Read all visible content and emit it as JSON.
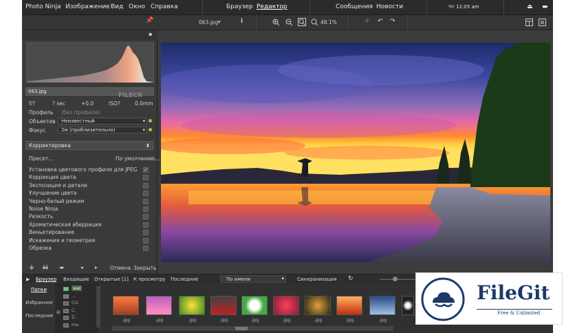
{
  "menu": {
    "app": "Photo Ninja",
    "image": "Изображение",
    "view": "Вид",
    "window": "Окно",
    "help": "Справка",
    "browser": "Браузер",
    "editor": "Редактор",
    "messages": "Сообщения",
    "news": "Новости",
    "clock": "Чт 12:05 am"
  },
  "toolbar": {
    "filename": "063.jpg",
    "zoom": "48.1%"
  },
  "watermark": "FILECR",
  "info": {
    "filename": "063.jpg",
    "aperture": "f/?",
    "shutter": "? sec",
    "ev": "+0.0",
    "iso": "ISO?",
    "focal": "0.0mm",
    "profile_label": "Профиль",
    "profile_value": "(без профиля)",
    "lens_label": "Объектив",
    "lens_value": "Неизвестный",
    "focus_label": "Фокус",
    "focus_value": "2м (приблизительно)"
  },
  "corrections": {
    "title": "Корректировка",
    "preset": "Пресет...",
    "default": "По умолчанию...",
    "items": [
      "Установка цветового профиля для JPEG",
      "Коррекция цвета",
      "Экспозиция и детали",
      "Улучшение цвета",
      "Черно-белый режим",
      "Noise Ninja",
      "Резкость",
      "Хроматическая аберрация",
      "Виньетирование",
      "Искажения и геометрия",
      "Обрезка"
    ],
    "cancel": "Отмена",
    "close": "Закрыть"
  },
  "bottombar": {
    "browser": "Браузер",
    "incoming": "Входящие",
    "opened": "Открытые [1]",
    "to_view": "К просмотру",
    "recent": "Последние",
    "sort": "По имени",
    "sync": "Синхронизация"
  },
  "browser": {
    "folders": "Папки",
    "favorites": "Избранное",
    "recent": "Последние",
    "tree": [
      "wal",
      "...",
      "CO",
      "C.",
      "Z..",
      "me"
    ],
    "thumb_label": ".jpg"
  },
  "filegit": {
    "name": "FileGit",
    "tagline": "Free & Unlimited"
  }
}
